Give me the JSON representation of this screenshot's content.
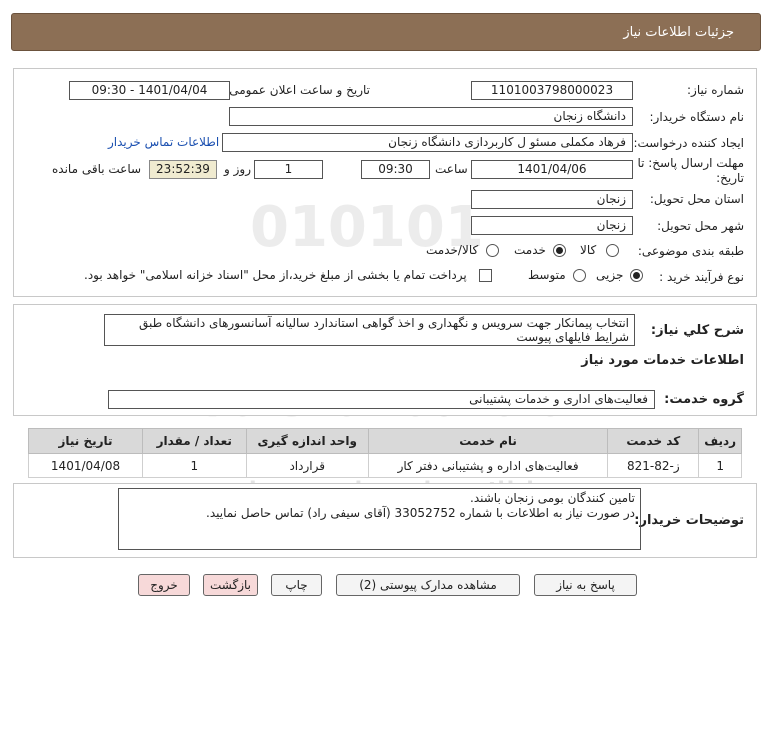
{
  "window": {
    "title": "جزئیات اطلاعات نیاز"
  },
  "form": {
    "need_number_label": "شماره نیاز:",
    "need_number": "1101003798000023",
    "announce_label": "تاریخ و ساعت اعلان عمومی:",
    "announce_value": "1401/04/04 - 09:30",
    "buyer_org_label": "نام دستگاه خریدار:",
    "buyer_org": "دانشگاه زنجان",
    "creator_label": "ایجاد کننده درخواست:",
    "creator": "فرهاد مکملی مسئو ل کاربردازی دانشگاه زنجان",
    "contact_link": "اطلاعات تماس خریدار",
    "deadline_label_1": "مهلت ارسال پاسخ: تا",
    "deadline_label_2": "تاریخ:",
    "deadline_date": "1401/04/06",
    "time_label": "ساعت",
    "deadline_time": "09:30",
    "days_value": "1",
    "days_label": "روز و",
    "remaining_time": "23:52:39",
    "remaining_label": "ساعت باقی مانده",
    "province_label": "استان محل تحویل:",
    "province": "زنجان",
    "city_label": "شهر محل تحویل:",
    "city": "زنجان",
    "category_label": "طبقه بندی موضوعی:",
    "category_options": [
      "کالا",
      "خدمت",
      "کالا/خدمت"
    ],
    "category_selected": "خدمت",
    "process_label": "نوع فرآیند خرید :",
    "process_options": [
      "جزیی",
      "متوسط"
    ],
    "process_selected": "جزیی",
    "payment_text": "پرداخت تمام یا بخشی از مبلغ خرید،از محل \"اسناد خزانه اسلامی\" خواهد بود."
  },
  "description": {
    "label": "شرح کلي نیاز:",
    "text": "انتخاب پیمانکار جهت سرویس و نگهداری و اخذ گواهی استاندارد سالیانه آسانسورهای دانشگاه طبق شرایط فایلهای پیوست"
  },
  "services": {
    "heading": "اطلاعات خدمات مورد نیاز",
    "group_label": "گروه خدمت:",
    "group_value": "فعالیت‌های اداری و خدمات پشتیبانی",
    "columns": [
      "ردیف",
      "کد خدمت",
      "نام خدمت",
      "واحد اندازه گیری",
      "تعداد / مقدار",
      "تاریخ نیاز"
    ],
    "rows": [
      [
        "1",
        "ز-82-821",
        "فعالیت‌های اداره و پشتیبانی دفتر کار",
        "قرارداد",
        "1",
        "1401/04/08"
      ]
    ]
  },
  "buyer_notes": {
    "label": "توضیحات خریدار:",
    "line1": "تامین کنندگان بومی زنجان باشند.",
    "line2": "در صورت نیاز به اطلاعات با شماره 33052752 (آقای سیفی راد) تماس حاصل نمایید."
  },
  "buttons": {
    "respond": "پاسخ به نیاز",
    "view_docs": "مشاهده مدارک پیوستی (2)",
    "print": "چاپ",
    "back": "بازگشت",
    "exit": "خروج"
  },
  "watermark": {
    "text1": "ParsNamadData",
    "text2": "مرکز فراوری اطلاعات پارس نماد داده",
    "text3": "اطلاع رسانی مناقصه ومزایده",
    "text4": "۰۲۱-۸۸۳۴۹۶۷۰-۵"
  },
  "colors": {
    "titlebar": "#8c6f55",
    "timer_bg": "#f0ebd0",
    "link": "#1a4fb0",
    "pink_button": "#f7d9d9"
  }
}
